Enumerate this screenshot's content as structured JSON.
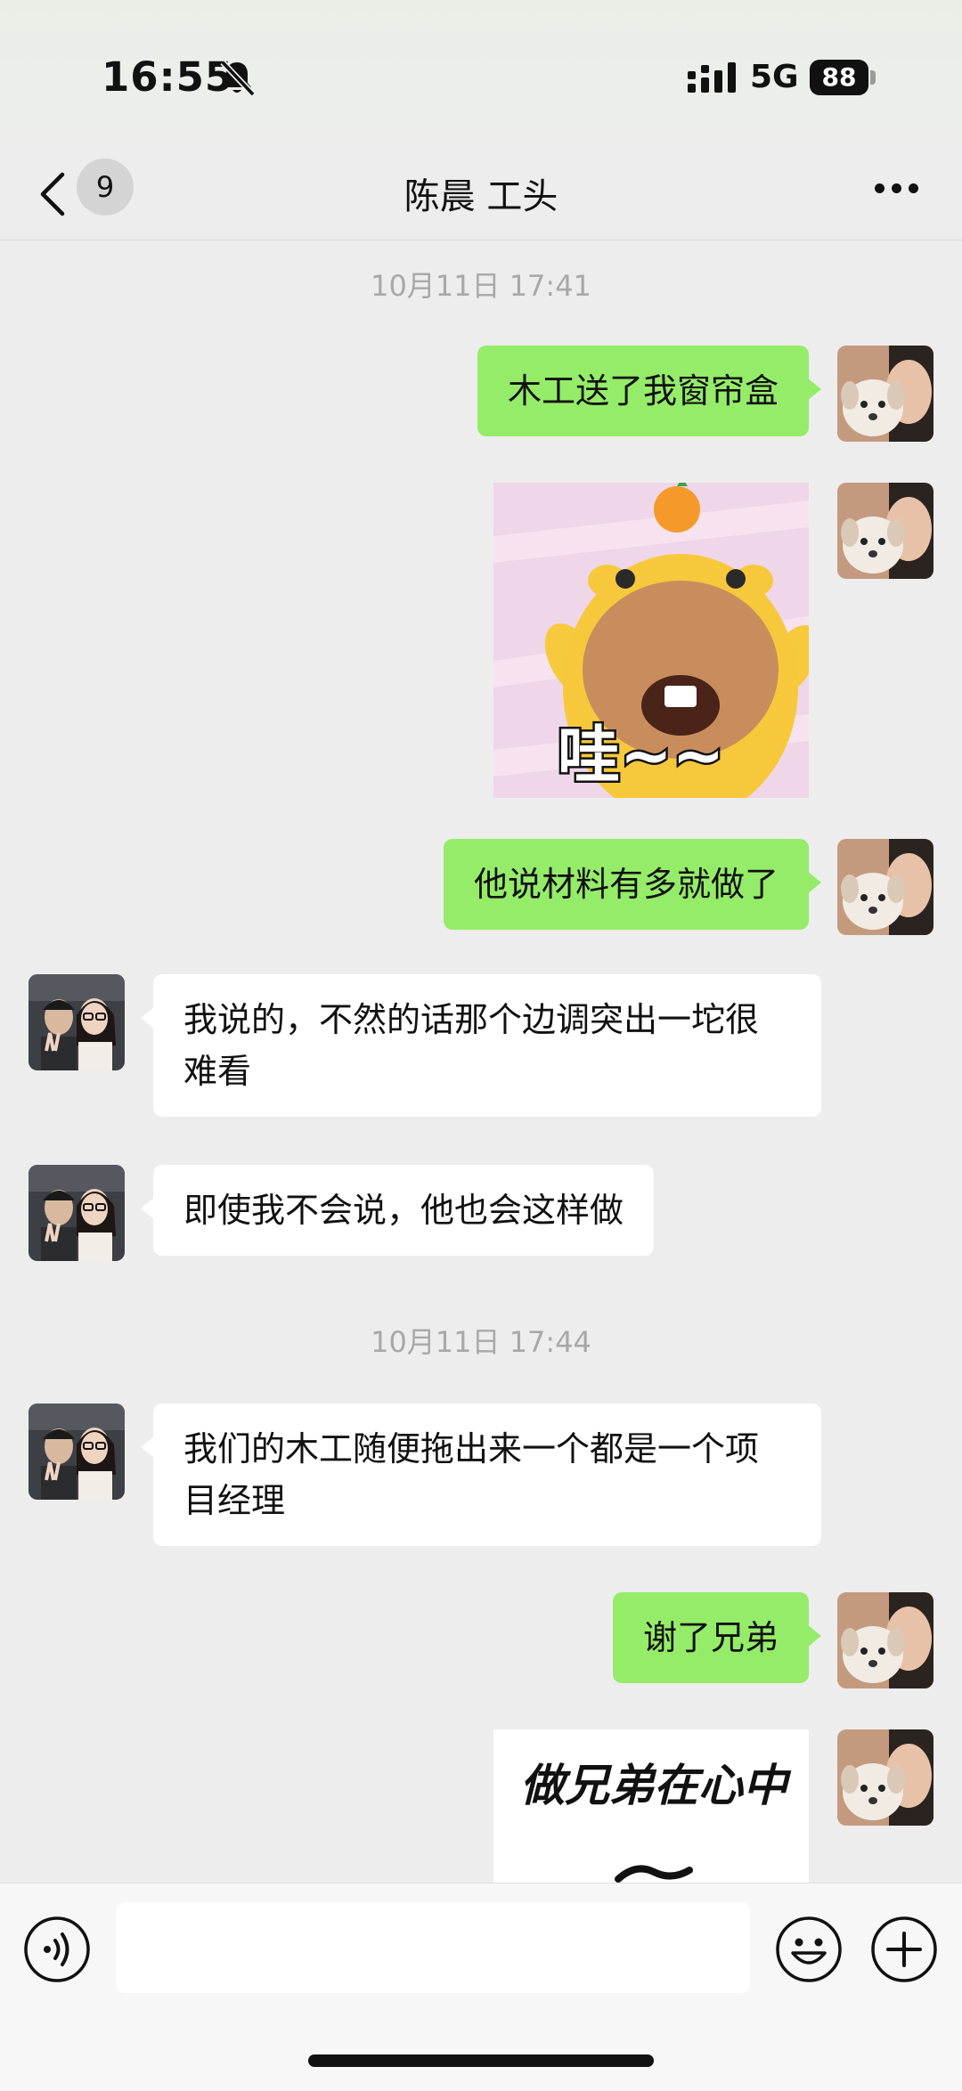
{
  "status_bar": {
    "time": "16:55",
    "network": "5G",
    "battery": "88"
  },
  "nav": {
    "unread_count": "9",
    "title": "陈晨 工头"
  },
  "messages": {
    "ts1": "10月11日 17:41",
    "m1": "木工送了我窗帘盒",
    "sticker1_text": "哇~~",
    "m2": "他说材料有多就做了",
    "m3": "我说的，不然的话那个边调突出一坨很难看",
    "m4": "即使我不会说，他也会这样做",
    "ts2": "10月11日 17:44",
    "m5": "我们的木工随便拖出来一个都是一个项目经理",
    "m6": "谢了兄弟",
    "sticker2_text": "做兄弟在心中"
  },
  "input": {
    "placeholder": ""
  },
  "colors": {
    "outgoing_bubble": "#95ec69",
    "incoming_bubble": "#ffffff",
    "background": "#ededed"
  },
  "icons": {
    "back": "chevron-left-icon",
    "more": "more-dots-icon",
    "voice": "voice-icon",
    "emoji": "smiley-icon",
    "plus": "plus-circle-icon",
    "mute": "bell-slash-icon"
  }
}
